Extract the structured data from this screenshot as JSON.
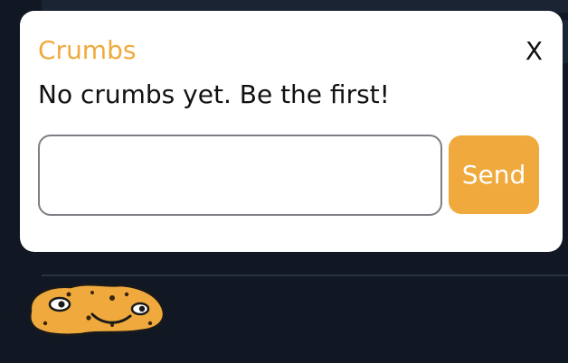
{
  "popup": {
    "title": "Crumbs",
    "close_label": "X",
    "empty_message": "No crumbs yet. Be the first!",
    "input_value": "",
    "send_label": "Send"
  },
  "colors": {
    "accent": "#f0a93c",
    "background": "#111723",
    "popup_bg": "#ffffff"
  },
  "mascot_icon": "cookie-mascot-icon"
}
